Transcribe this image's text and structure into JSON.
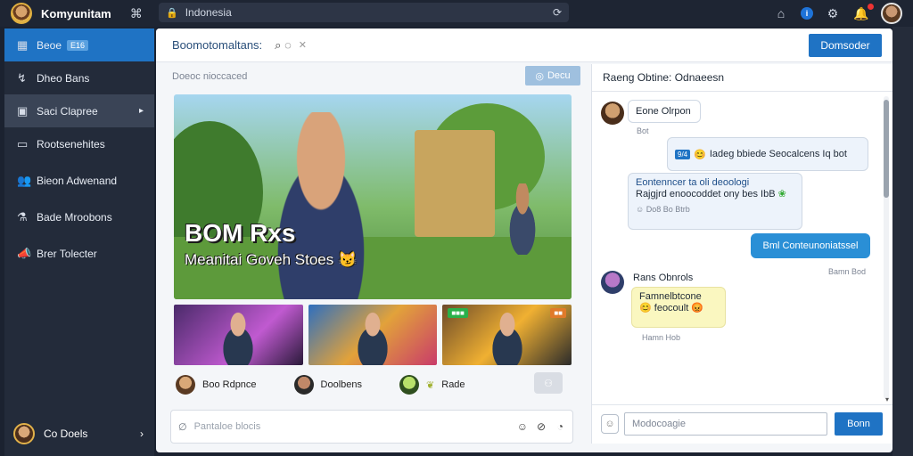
{
  "topbar": {
    "app_title": "Komyunitam",
    "search_text": "Indonesia",
    "icons": [
      "home-icon",
      "info-icon",
      "settings-icon",
      "notifications-icon"
    ],
    "info_badge": "i"
  },
  "sidebar": {
    "items": [
      {
        "label": "Beoe",
        "tag": "E16",
        "icon": "grid-icon"
      },
      {
        "label": "Dheo Bans",
        "icon": "link-icon"
      },
      {
        "label": "Saci Clapree",
        "icon": "image-icon"
      },
      {
        "label": "Rootsenehites",
        "icon": "chat-icon"
      },
      {
        "label": "Bieon Adwenand",
        "icon": "users-icon"
      },
      {
        "label": "Bade Mroobons",
        "icon": "flask-icon"
      },
      {
        "label": "Brer Tolecter",
        "icon": "megaphone-icon"
      }
    ],
    "footer_label": "Co Doels"
  },
  "main": {
    "header_title": "Boomotomaltans:",
    "header_button": "Domsoder",
    "feed_label": "Doeoc nioccaced",
    "feed_tag": "Decu",
    "hero_title": "BOM Rxs",
    "hero_subtitle": "Meanitai Goveh Stoes",
    "users": [
      {
        "name": "Boo Rdpnce"
      },
      {
        "name": "Doolbens"
      },
      {
        "name": "Rade"
      }
    ],
    "composer_placeholder": "Pantaloe blocis"
  },
  "chat": {
    "title": "Raeng Obtine: Odnaeesn",
    "msg1_name": "Eone Olrpon",
    "msg1_time": "Bot",
    "msg2_text": "Iadeg bbiede Seocalcens Iq bot",
    "msg2_chip": "9/4",
    "msg3_line1": "Eontenncer ta oli deoologi",
    "msg3_line2": "Rajgjrd enoocoddet ony bes IbB",
    "msg3_meta": "Do8 Bo Btrb",
    "msg4_text": "Bml Conteunoniatssel",
    "msg5_name": "Rans Obnrols",
    "msg5_time": "Bamn Bod",
    "msg5_line1": "Famnelbtcone",
    "msg5_line2": "feocoult",
    "msg5_timestamp": "Hamn Hob",
    "input_placeholder": "Modocoagie",
    "send_label": "Bonn"
  }
}
